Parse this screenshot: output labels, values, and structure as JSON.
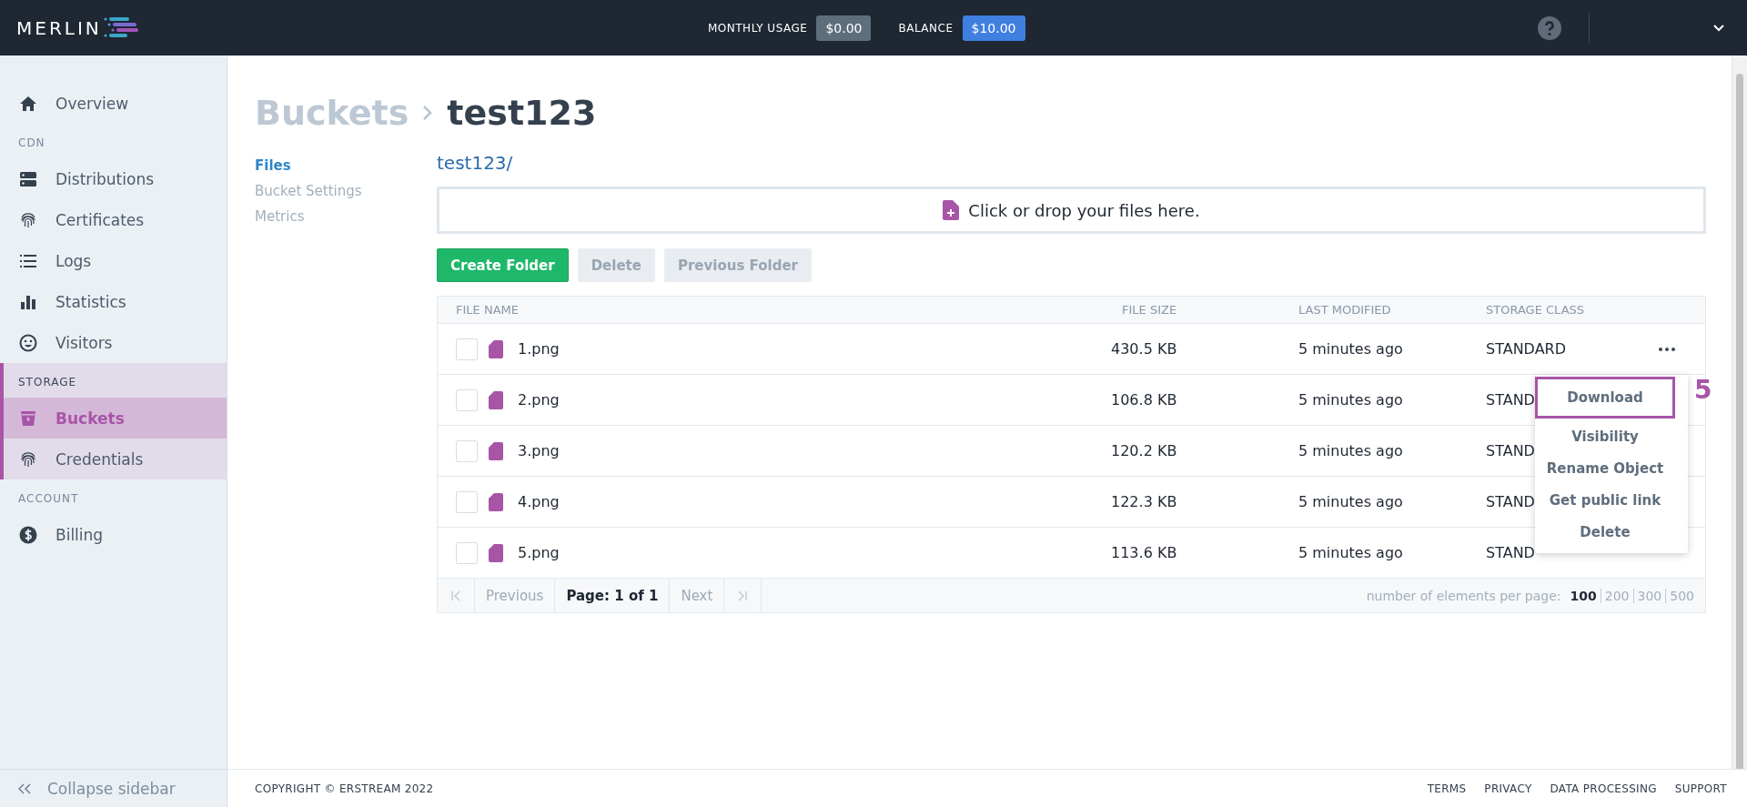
{
  "topbar": {
    "logo": "MERLIN",
    "usage_label": "MONTHLY USAGE",
    "usage_value": "$0.00",
    "balance_label": "BALANCE",
    "balance_value": "$10.00"
  },
  "sidebar": {
    "groups": [
      {
        "active": false,
        "items": [
          {
            "label": "Overview",
            "selected": false
          }
        ]
      },
      {
        "title": "CDN",
        "active": false,
        "items": [
          {
            "label": "Distributions",
            "selected": false
          },
          {
            "label": "Certificates",
            "selected": false
          },
          {
            "label": "Logs",
            "selected": false
          },
          {
            "label": "Statistics",
            "selected": false
          },
          {
            "label": "Visitors",
            "selected": false
          }
        ]
      },
      {
        "title": "STORAGE",
        "active": true,
        "items": [
          {
            "label": "Buckets",
            "selected": true
          },
          {
            "label": "Credentials",
            "selected": false
          }
        ]
      },
      {
        "title": "ACCOUNT",
        "active": false,
        "items": [
          {
            "label": "Billing",
            "selected": false
          }
        ]
      }
    ],
    "collapse": "Collapse sidebar"
  },
  "breadcrumb": {
    "parent": "Buckets",
    "current": "test123"
  },
  "subnav": [
    {
      "label": "Files",
      "selected": true
    },
    {
      "label": "Bucket Settings",
      "selected": false
    },
    {
      "label": "Metrics",
      "selected": false
    }
  ],
  "path": "test123/",
  "dropzone": "Click or drop your files here.",
  "buttons": [
    {
      "label": "Create Folder",
      "disabled": false
    },
    {
      "label": "Delete",
      "disabled": true
    },
    {
      "label": "Previous Folder",
      "disabled": true
    }
  ],
  "table": {
    "columns": [
      "FILE NAME",
      "FILE SIZE",
      "LAST MODIFIED",
      "STORAGE CLASS"
    ],
    "rows": [
      {
        "checked": false,
        "name": "1.png",
        "size": "430.5 KB",
        "modified": "5 minutes ago",
        "storage_class": "STANDARD",
        "menu_open": true
      },
      {
        "checked": false,
        "name": "2.png",
        "size": "106.8 KB",
        "modified": "5 minutes ago",
        "storage_class": "STAND",
        "menu_open": false
      },
      {
        "checked": false,
        "name": "3.png",
        "size": "120.2 KB",
        "modified": "5 minutes ago",
        "storage_class": "STAND",
        "menu_open": false
      },
      {
        "checked": false,
        "name": "4.png",
        "size": "122.3 KB",
        "modified": "5 minutes ago",
        "storage_class": "STAND",
        "menu_open": false
      },
      {
        "checked": false,
        "name": "5.png",
        "size": "113.6 KB",
        "modified": "5 minutes ago",
        "storage_class": "STAND",
        "menu_open": false
      }
    ]
  },
  "row_menu": {
    "items": [
      {
        "label": "Download",
        "selected": true
      },
      {
        "label": "Visibility",
        "selected": false
      },
      {
        "label": "Rename Object",
        "selected": false
      },
      {
        "label": "Get public link",
        "selected": false
      },
      {
        "label": "Delete",
        "selected": false
      }
    ],
    "annotation": "5"
  },
  "pagination": {
    "previous": "Previous",
    "page": "Page: 1 of 1",
    "next": "Next",
    "per_page_label": "number of elements per page:",
    "sizes": [
      {
        "label": "100",
        "selected": true
      },
      {
        "label": "200",
        "selected": false
      },
      {
        "label": "300",
        "selected": false
      },
      {
        "label": "500",
        "selected": false
      }
    ]
  },
  "footer": {
    "copyright": "COPYRIGHT © ERSTREAM 2022",
    "links": [
      "TERMS",
      "PRIVACY",
      "DATA PROCESSING",
      "SUPPORT"
    ]
  }
}
